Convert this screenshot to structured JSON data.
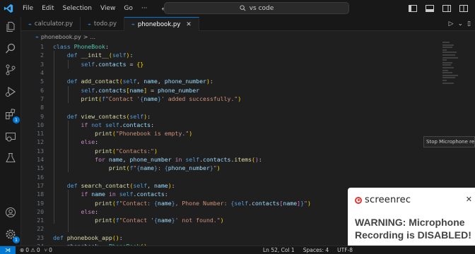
{
  "menu": [
    "File",
    "Edit",
    "Selection",
    "View",
    "Go",
    "···"
  ],
  "search": {
    "text": "vs code"
  },
  "tabs": [
    {
      "label": "calculator.py",
      "active": false
    },
    {
      "label": "todo.py",
      "active": false
    },
    {
      "label": "phonebook.py",
      "active": true
    }
  ],
  "breadcrumb": {
    "file": "phonebook.py",
    "sep": ">",
    "more": "..."
  },
  "editor": {
    "line_numbers": [
      "1",
      "2",
      "3",
      "4",
      "5",
      "6",
      "7",
      "8",
      "9",
      "10",
      "11",
      "12",
      "13",
      "14",
      "15",
      "16",
      "17",
      "18",
      "19",
      "20",
      "21",
      "22",
      "23",
      "24"
    ]
  },
  "tooltip": "Stop Microphone recording",
  "popup": {
    "brand": "screenrec",
    "warning": "WARNING: Microphone Recording is DISABLED!"
  },
  "status": {
    "errors": "0",
    "warnings": "0",
    "ports": "0",
    "position": "Ln 52, Col 1",
    "spaces": "Spaces: 4",
    "encoding": "UTF-8"
  },
  "activity_badge": "1",
  "colors": {
    "accent": "#0078d4",
    "background": "#1f1f1f",
    "sidebar": "#181818",
    "warning_text": "#444444",
    "record_red": "#e53935"
  }
}
